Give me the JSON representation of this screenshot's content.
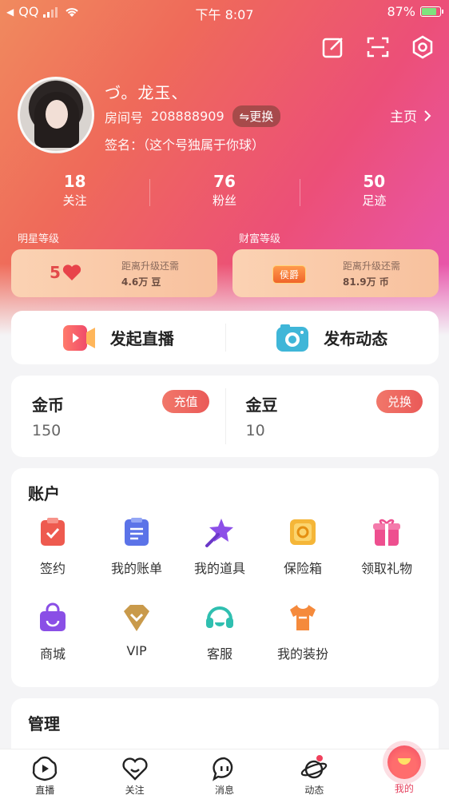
{
  "status_bar": {
    "carrier": "QQ",
    "time": "下午 8:07",
    "battery": "87%"
  },
  "profile": {
    "nickname": "づ。龙玉、",
    "room_label": "房间号",
    "room_id": "208888909",
    "swap_label": "⇋更换",
    "signature": "签名：（这个号独属于你球）",
    "homepage_label": "主页"
  },
  "stats": [
    {
      "value": "18",
      "label": "关注"
    },
    {
      "value": "76",
      "label": "粉丝"
    },
    {
      "value": "50",
      "label": "足迹"
    }
  ],
  "levels": {
    "star": {
      "title": "明星等级",
      "level": "5",
      "desc": "距离升级还需",
      "amount": "4.6万 豆"
    },
    "wealth": {
      "title": "财富等级",
      "badge": "侯爵",
      "desc": "距离升级还需",
      "amount": "81.9万 币"
    }
  },
  "actions": {
    "live": "发起直播",
    "post": "发布动态"
  },
  "wallet": {
    "coin": {
      "name": "金币",
      "value": "150",
      "button": "充值"
    },
    "bean": {
      "name": "金豆",
      "value": "10",
      "button": "兑换"
    }
  },
  "account": {
    "title": "账户",
    "items": [
      {
        "label": "签约",
        "icon": "contract-icon"
      },
      {
        "label": "我的账单",
        "icon": "bill-icon"
      },
      {
        "label": "我的道具",
        "icon": "wand-icon"
      },
      {
        "label": "保险箱",
        "icon": "safe-icon"
      },
      {
        "label": "领取礼物",
        "icon": "gift-icon"
      },
      {
        "label": "商城",
        "icon": "shop-bag-icon"
      },
      {
        "label": "VIP",
        "icon": "vip-icon"
      },
      {
        "label": "客服",
        "icon": "headset-icon"
      },
      {
        "label": "我的装扮",
        "icon": "tshirt-icon"
      }
    ]
  },
  "manage": {
    "title": "管理"
  },
  "tabs": [
    {
      "label": "直播",
      "icon": "live-play-icon"
    },
    {
      "label": "关注",
      "icon": "heart-icon"
    },
    {
      "label": "消息",
      "icon": "message-icon"
    },
    {
      "label": "动态",
      "icon": "planet-icon"
    },
    {
      "label": "我的",
      "icon": "mine-icon"
    }
  ],
  "colors": {
    "accent": "#ea5a58",
    "hero_start": "#f08a5e",
    "hero_end": "#e758b6"
  }
}
